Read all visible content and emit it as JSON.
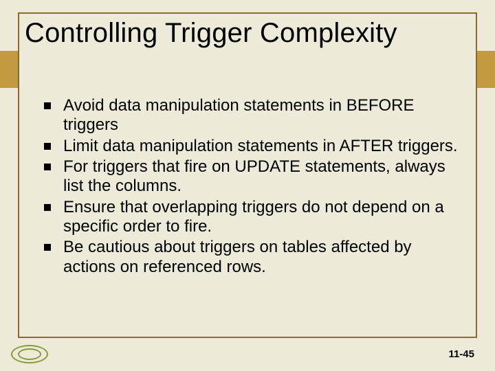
{
  "slide": {
    "title": "Controlling Trigger Complexity",
    "bullets": [
      "Avoid data manipulation statements in BEFORE triggers",
      "Limit data manipulation statements in AFTER triggers.",
      "For triggers that fire on UPDATE statements, always list the columns.",
      "Ensure that overlapping triggers do not depend on a specific order to fire.",
      "Be cautious about triggers on tables affected by actions on referenced rows."
    ],
    "page_number": "11-45"
  }
}
